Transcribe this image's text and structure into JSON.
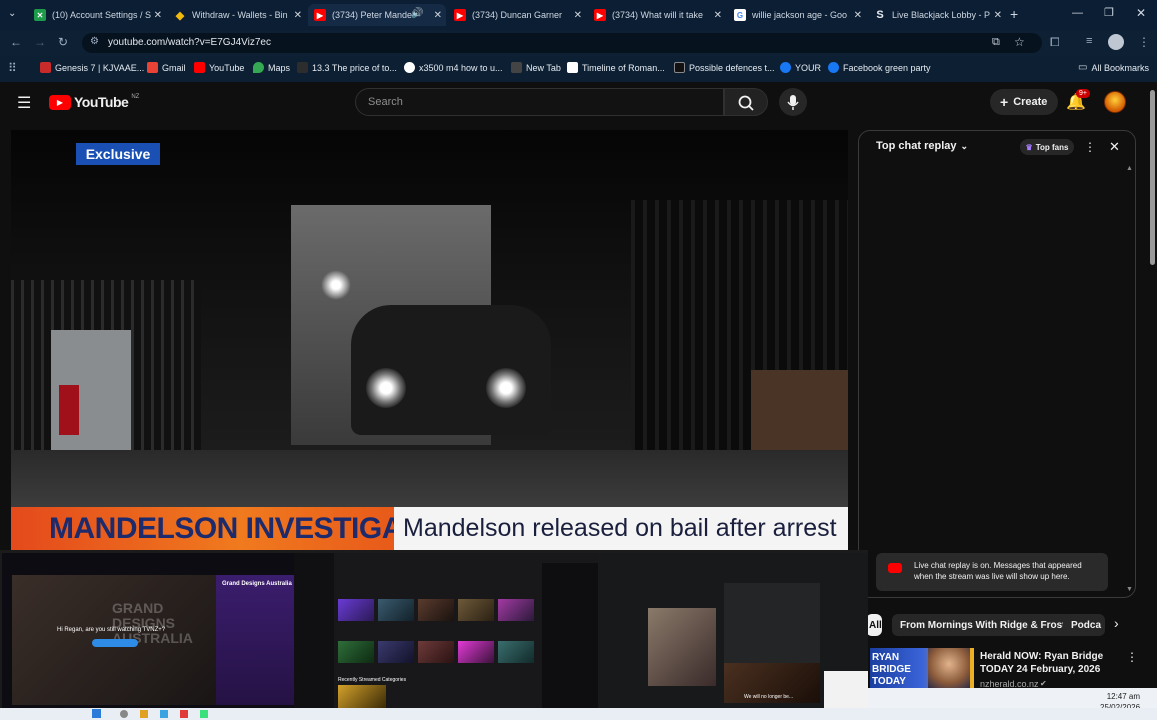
{
  "browser": {
    "tabs": [
      {
        "title": "(10) Account Settings / S",
        "icon": "x-icon",
        "color": "#1d9b4a"
      },
      {
        "title": "Withdraw - Wallets - Bin",
        "icon": "binance-icon",
        "color": "#f0b90b"
      },
      {
        "title": "(3734) Peter Mandel",
        "icon": "youtube-icon",
        "color": "#ff0000"
      },
      {
        "title": "(3734) Duncan Garner",
        "icon": "youtube-icon",
        "color": "#ff0000"
      },
      {
        "title": "(3734) What will it take",
        "icon": "youtube-icon",
        "color": "#ff0000"
      },
      {
        "title": "willie jackson age - Goo",
        "icon": "google-icon",
        "color": "#ffffff"
      },
      {
        "title": "Live Blackjack Lobby - P",
        "icon": "stake-icon",
        "color": "#2b6cff"
      }
    ],
    "new_tab": "+",
    "url": "youtube.com/watch?v=E7GJ4Viz7ec",
    "bookmarks": [
      {
        "label": "Genesis 7 | KJVAAE...",
        "color": "#c92a2a"
      },
      {
        "label": "Gmail",
        "color": "#ea4335"
      },
      {
        "label": "YouTube",
        "color": "#ff0000"
      },
      {
        "label": "Maps",
        "color": "#34a853"
      },
      {
        "label": "13.3 The price of to...",
        "color": "#2d2d2d"
      },
      {
        "label": "x3500 m4 how to u...",
        "color": "#ffffff"
      },
      {
        "label": "New Tab",
        "color": "#444444"
      },
      {
        "label": "Timeline of Roman...",
        "color": "#ffffff"
      },
      {
        "label": "Possible defences t...",
        "color": "#111111"
      },
      {
        "label": "YOUR",
        "color": "#1877f2"
      },
      {
        "label": "Facebook green party",
        "color": "#1877f2"
      }
    ],
    "all_bookmarks": "All Bookmarks"
  },
  "youtube": {
    "logo_text": "YouTube",
    "region": "NZ",
    "search_placeholder": "Search",
    "create_label": "Create",
    "notifications_badge": "9+"
  },
  "video": {
    "badge": "Exclusive",
    "lower_third_left": "MANDELSON INVESTIGATION",
    "lower_third_right": "Mandelson released on bail after arrest"
  },
  "chat": {
    "title": "Top chat replay",
    "top_fans": "Top fans",
    "notice": "Live chat replay is on. Messages that appeared when the stream was live will show up here."
  },
  "chips": [
    "All",
    "From Mornings With Ridge & Frost",
    "Podca"
  ],
  "suggestion": {
    "thumb_text": "RYAN BRIDGE TODAY",
    "title": "Herald NOW: Ryan Bridge TODAY 24 February, 2026",
    "channel": "nzherald.co.nz"
  },
  "thumbnails": {
    "t1_title": "Grand Designs Australia",
    "t1_prompt": "Hi Regan, are you still watching TVNZ+?",
    "t1_brand": "GRAND DESIGNS AUSTRALIA",
    "t2_heading": "Recently Streamed Categories",
    "t3_caption": "We will no longer be..."
  },
  "clock": {
    "time": "12:47 am",
    "date": "25/02/2026"
  }
}
